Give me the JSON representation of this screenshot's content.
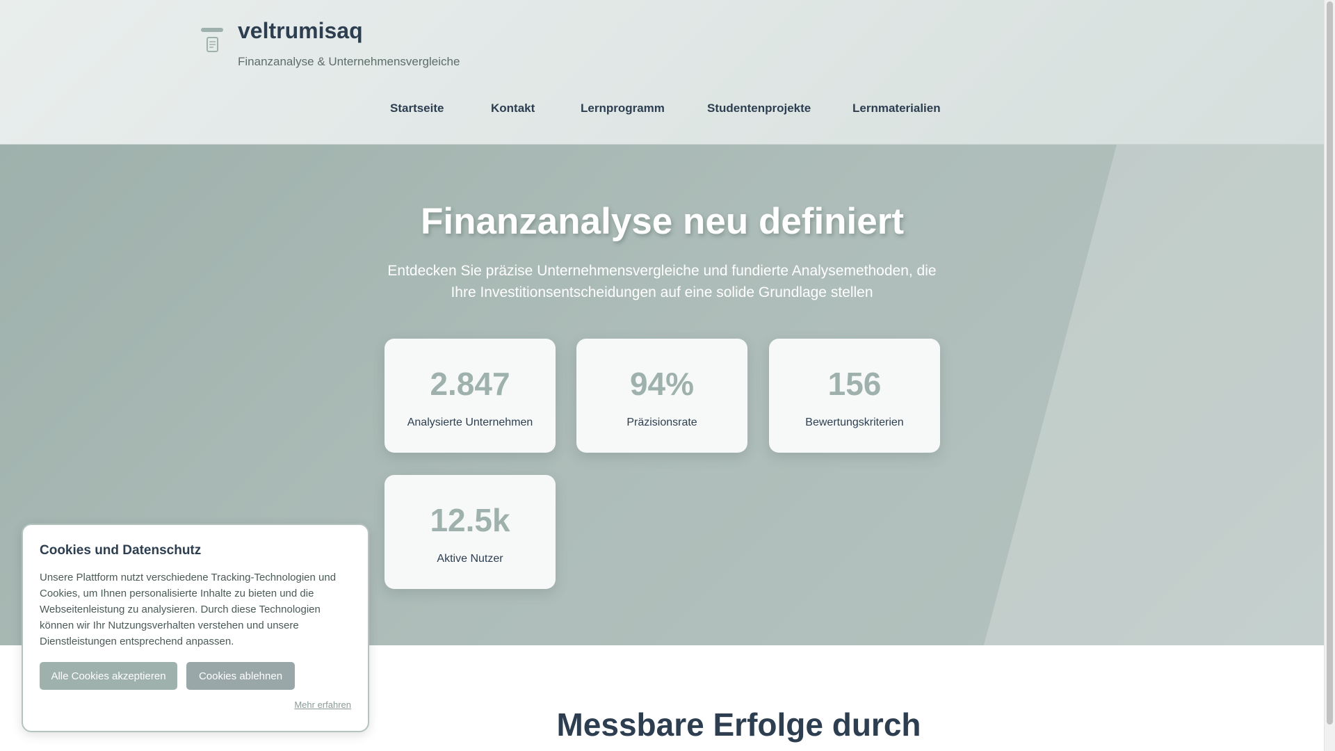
{
  "header": {
    "brand": "veltrumisaq",
    "tagline": "Finanzanalyse & Unternehmensvergleiche",
    "logo_icon": "document-icon"
  },
  "nav": {
    "items": [
      {
        "label": "Startseite"
      },
      {
        "label": "Kontakt"
      },
      {
        "label": "Lernprogramm"
      },
      {
        "label": "Studentenprojekte"
      },
      {
        "label": "Lernmaterialien"
      }
    ]
  },
  "hero": {
    "title": "Finanzanalyse neu definiert",
    "subtitle": "Entdecken Sie präzise Unternehmensvergleiche und fundierte Analysemethoden, die Ihre Investitionsentscheidungen auf eine solide Grundlage stellen",
    "stats": [
      {
        "value": "2.847",
        "label": "Analysierte Unternehmen"
      },
      {
        "value": "94%",
        "label": "Präzisionsrate"
      },
      {
        "value": "156",
        "label": "Bewertungskriterien"
      },
      {
        "value": "12.5k",
        "label": "Aktive Nutzer"
      }
    ]
  },
  "section2": {
    "title": "Messbare Erfolge durch"
  },
  "cookie": {
    "title": "Cookies und Datenschutz",
    "text": "Unsere Plattform nutzt verschiedene Tracking-Technologien und Cookies, um Ihnen personalisierte Inhalte zu bieten und die Webseitenleistung zu analysieren. Durch diese Technologien können wir Ihr Nutzungsverhalten verstehen und unsere Dienstleistungen entsprechend anpassen.",
    "accept_label": "Alle Cookies akzeptieren",
    "decline_label": "Cookies ablehnen",
    "more_label": "Mehr erfahren"
  },
  "colors": {
    "accent": "#9fb1ac",
    "text_dark": "#2c3e50",
    "decline": "#9aa7a8"
  }
}
